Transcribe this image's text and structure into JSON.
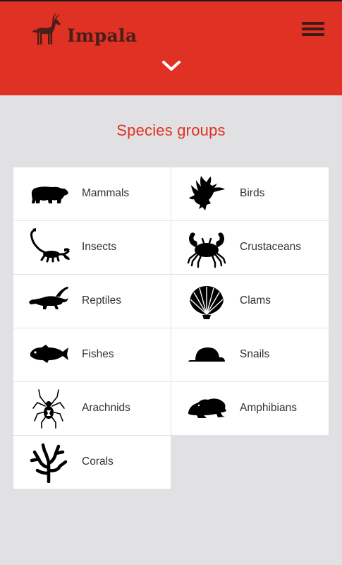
{
  "app": {
    "name": "Impala"
  },
  "colors": {
    "brand_red": "#df3124",
    "header_text": "#4a1e19",
    "background": "#e1e1e3"
  },
  "header": {
    "menu_icon": "hamburger-menu-icon",
    "expand_icon": "chevron-down-icon"
  },
  "page": {
    "title": "Species groups"
  },
  "groups": [
    {
      "label": "Mammals",
      "icon": "bear-icon"
    },
    {
      "label": "Birds",
      "icon": "eagle-icon"
    },
    {
      "label": "Insects",
      "icon": "scorpion-icon"
    },
    {
      "label": "Crustaceans",
      "icon": "crab-icon"
    },
    {
      "label": "Reptiles",
      "icon": "crocodile-icon"
    },
    {
      "label": "Clams",
      "icon": "clam-shell-icon"
    },
    {
      "label": "Fishes",
      "icon": "fish-icon"
    },
    {
      "label": "Snails",
      "icon": "snail-shell-icon"
    },
    {
      "label": "Arachnids",
      "icon": "spider-icon"
    },
    {
      "label": "Amphibians",
      "icon": "frog-icon"
    },
    {
      "label": "Corals",
      "icon": "coral-icon"
    }
  ]
}
